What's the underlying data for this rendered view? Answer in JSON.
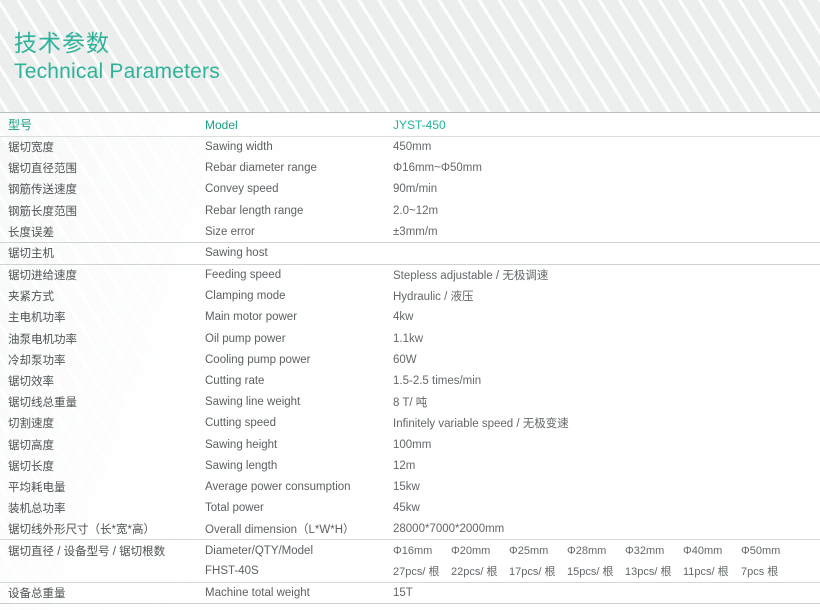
{
  "header": {
    "title_cn": "技术参数",
    "title_en": "Technical Parameters",
    "accent_color": "#2eb39a"
  },
  "table": {
    "columns": {
      "cn_header": "型号",
      "en_header": "Model",
      "value_header": "JYST-450"
    },
    "rows": [
      {
        "cn": "锯切宽度",
        "en": "Sawing width",
        "value": "450mm"
      },
      {
        "cn": "锯切直径范围",
        "en": "Rebar diameter range",
        "value": "Φ16mm~Φ50mm"
      },
      {
        "cn": "钢筋传送速度",
        "en": "Convey speed",
        "value": "90m/min"
      },
      {
        "cn": "钢筋长度范围",
        "en": "Rebar length range",
        "value": "2.0~12m"
      },
      {
        "cn": "长度误差",
        "en": "Size error",
        "value": "±3mm/m"
      },
      {
        "cn": "锯切主机",
        "en": "Sawing host",
        "value": "",
        "divider": true
      },
      {
        "cn": "锯切进给速度",
        "en": "Feeding speed",
        "value": "Stepless adjustable / 无极调速"
      },
      {
        "cn": "夹紧方式",
        "en": "Clamping mode",
        "value": "Hydraulic / 液压"
      },
      {
        "cn": "主电机功率",
        "en": "Main motor power",
        "value": "4kw"
      },
      {
        "cn": "油泵电机功率",
        "en": "Oil pump power",
        "value": "1.1kw"
      },
      {
        "cn": "冷却泵功率",
        "en": "Cooling pump power",
        "value": "60W"
      },
      {
        "cn": "锯切效率",
        "en": "Cutting rate",
        "value": "1.5-2.5 times/min"
      },
      {
        "cn": "锯切线总重量",
        "en": "Sawing line weight",
        "value": "8 T/ 吨"
      },
      {
        "cn": "切割速度",
        "en": "Cutting speed",
        "value": "Infinitely variable speed / 无极变速"
      },
      {
        "cn": "锯切高度",
        "en": "Sawing height",
        "value": "100mm"
      },
      {
        "cn": "锯切长度",
        "en": "Sawing length",
        "value": "12m"
      },
      {
        "cn": "平均耗电量",
        "en": "Average power consumption",
        "value": "15kw"
      },
      {
        "cn": "装机总功率",
        "en": "Total power",
        "value": "45kw"
      },
      {
        "cn": "锯切线外形尺寸（长*宽*高）",
        "en": "Overall dimension（L*W*H）",
        "value": "28000*7000*2000mm"
      }
    ],
    "diameter_section": {
      "cn": "锯切直径 / 设备型号 / 锯切根数",
      "en_label": "Diameter/QTY/Model",
      "model": "FHST-40S",
      "diameters": [
        "Φ16mm",
        "Φ20mm",
        "Φ25mm",
        "Φ28mm",
        "Φ32mm",
        "Φ40mm",
        "Φ50mm"
      ],
      "quantities": [
        "27pcs/ 根",
        "22pcs/ 根",
        "17pcs/ 根",
        "15pcs/ 根",
        "13pcs/ 根",
        "11pcs/ 根",
        "7pcs 根"
      ]
    },
    "last_row": {
      "cn": "设备总重量",
      "en": "Machine total weight",
      "value": "15T"
    }
  }
}
